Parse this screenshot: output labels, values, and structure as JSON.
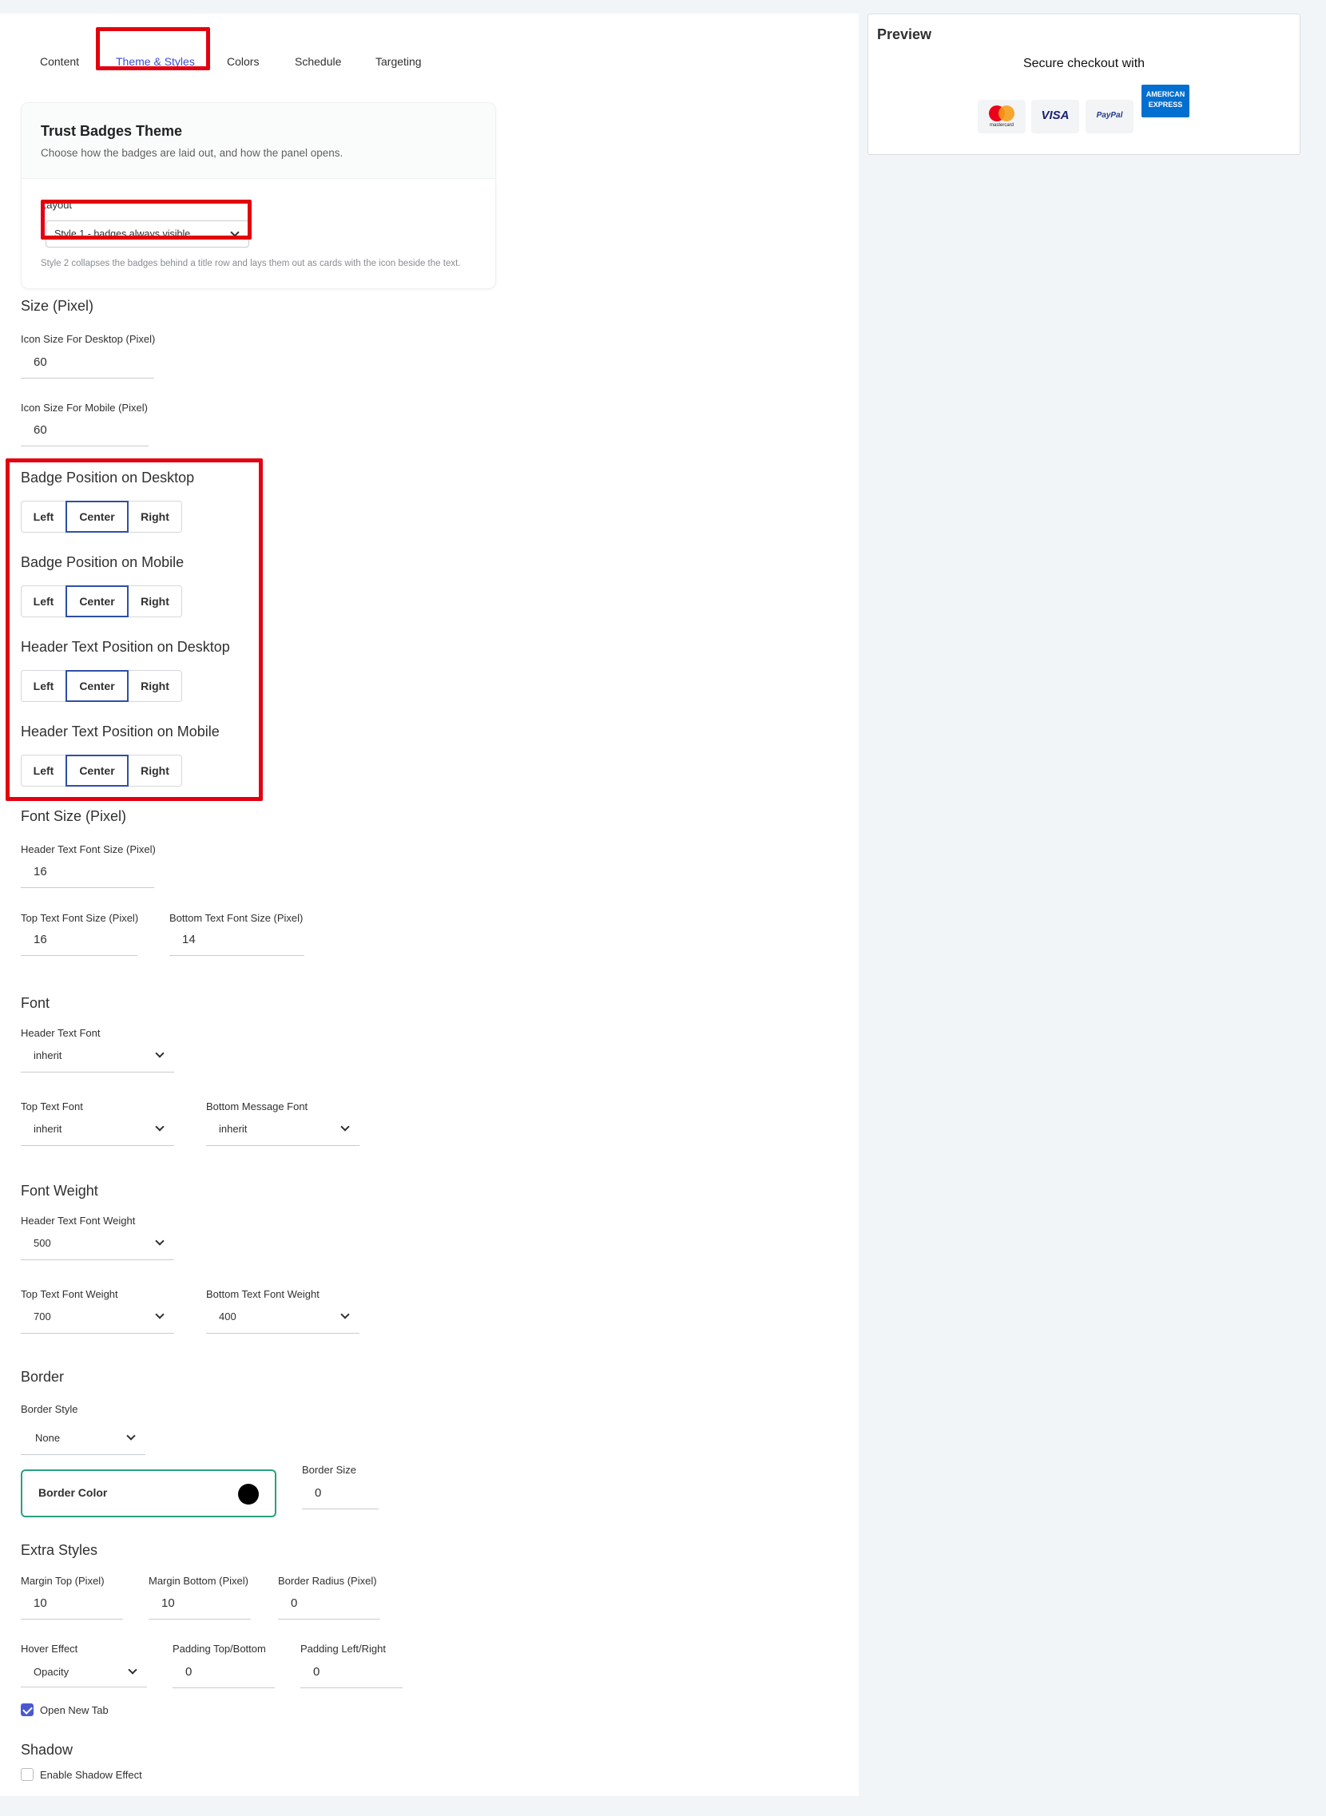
{
  "tabs": [
    {
      "label": "Content"
    },
    {
      "label": "Theme & Styles"
    },
    {
      "label": "Colors"
    },
    {
      "label": "Schedule"
    },
    {
      "label": "Targeting"
    }
  ],
  "theme_card": {
    "title": "Trust Badges Theme",
    "subtitle": "Choose how the badges are laid out, and how the panel opens.",
    "layout_label": "Layout",
    "layout_value": "Style 1 - badges always visible",
    "hint": "Style 2 collapses the badges behind a title row and lays them out as cards with the icon beside the text."
  },
  "size": {
    "title": "Size (Pixel)",
    "desktop_label": "Icon Size For Desktop (Pixel)",
    "desktop_value": "60",
    "mobile_label": "Icon Size For Mobile (Pixel)",
    "mobile_value": "60"
  },
  "positions": [
    {
      "title": "Badge Position on Desktop",
      "options": [
        "Left",
        "Center",
        "Right"
      ],
      "selected": "Center"
    },
    {
      "title": "Badge Position on Mobile",
      "options": [
        "Left",
        "Center",
        "Right"
      ],
      "selected": "Center"
    },
    {
      "title": "Header Text Position on Desktop",
      "options": [
        "Left",
        "Center",
        "Right"
      ],
      "selected": "Center"
    },
    {
      "title": "Header Text Position on Mobile",
      "options": [
        "Left",
        "Center",
        "Right"
      ],
      "selected": "Center"
    }
  ],
  "font_size": {
    "title": "Font Size (Pixel)",
    "header_label": "Header Text Font Size (Pixel)",
    "header_value": "16",
    "top_label": "Top Text Font Size (Pixel)",
    "top_value": "16",
    "bottom_label": "Bottom Text Font Size (Pixel)",
    "bottom_value": "14"
  },
  "font": {
    "title": "Font",
    "header_label": "Header Text Font",
    "header_value": "inherit",
    "top_label": "Top Text Font",
    "top_value": "inherit",
    "bottom_label": "Bottom Message Font",
    "bottom_value": "inherit"
  },
  "font_weight": {
    "title": "Font Weight",
    "header_label": "Header Text Font Weight",
    "header_value": "500",
    "top_label": "Top Text Font Weight",
    "top_value": "700",
    "bottom_label": "Bottom Text Font Weight",
    "bottom_value": "400"
  },
  "border": {
    "title": "Border",
    "style_label": "Border Style",
    "style_value": "None",
    "color_label": "Border Color",
    "color_value": "#000000",
    "size_label": "Border Size",
    "size_value": "0"
  },
  "extra": {
    "title": "Extra Styles",
    "margin_top_label": "Margin Top (Pixel)",
    "margin_top_value": "10",
    "margin_bottom_label": "Margin Bottom (Pixel)",
    "margin_bottom_value": "10",
    "radius_label": "Border Radius (Pixel)",
    "radius_value": "0",
    "hover_label": "Hover Effect",
    "hover_value": "Opacity",
    "pad_tb_label": "Padding Top/Bottom",
    "pad_tb_value": "0",
    "pad_lr_label": "Padding Left/Right",
    "pad_lr_value": "0",
    "open_new_tab_label": "Open New Tab",
    "open_new_tab_checked": true
  },
  "shadow": {
    "title": "Shadow",
    "enable_label": "Enable Shadow Effect",
    "enable_checked": false
  },
  "preview": {
    "title": "Preview",
    "heading": "Secure checkout with",
    "badges": [
      {
        "name": "mastercard-icon",
        "text": "mastercard"
      },
      {
        "name": "visa-icon",
        "text": "VISA"
      },
      {
        "name": "paypal-icon",
        "text": "PayPal"
      },
      {
        "name": "amex-icon",
        "text": "AMERICAN EXPRESS"
      }
    ]
  },
  "colors": {
    "accent": "#3b4fcc",
    "highlight": "#e3000f",
    "selected_border": "#2e4fa8",
    "border_color_card": "#2aa07d"
  }
}
